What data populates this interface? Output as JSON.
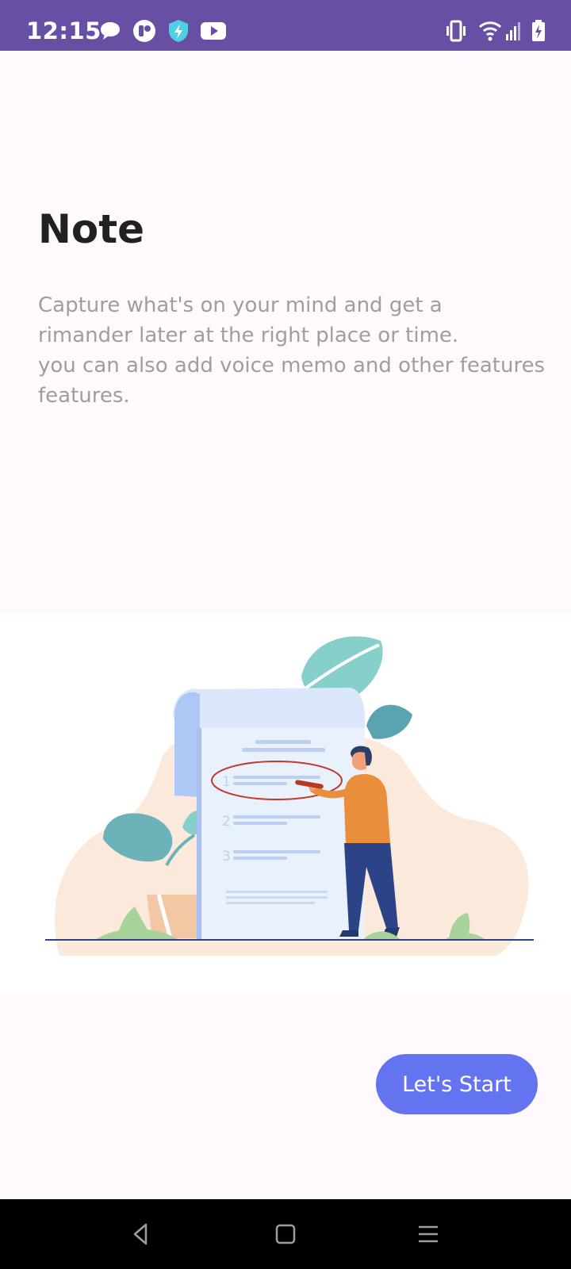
{
  "status_bar": {
    "time": "12:15",
    "background_color": "#6750a4",
    "left_icons": [
      "chat-bubble-icon",
      "messenger-app-icon",
      "shield-bolt-icon",
      "youtube-icon"
    ],
    "right_icons": [
      "vibrate-icon",
      "wifi-icon",
      "signal-icon",
      "battery-charging-icon"
    ]
  },
  "onboarding": {
    "title": "Note",
    "description_lines": [
      "Capture what's on your mind and get a",
      "rimander later at the right place or time.",
      "you can also add voice memo and other features",
      "features."
    ],
    "illustration": {
      "icon": "note-checklist-illustration",
      "list_numbers": [
        "1",
        "2",
        "3"
      ]
    },
    "start_button_label": "Let's Start",
    "accent_color": "#6474f0"
  },
  "nav_bar": {
    "icons": [
      "back-icon",
      "home-icon",
      "recents-icon"
    ]
  }
}
